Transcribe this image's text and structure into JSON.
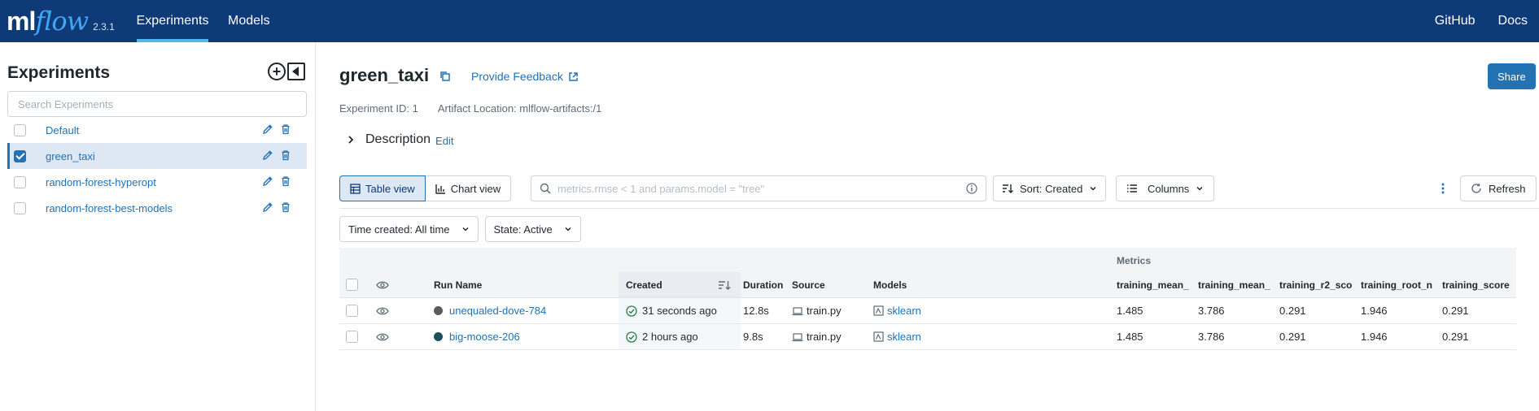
{
  "topbar": {
    "logo_ml": "ml",
    "logo_flow": "flow",
    "version": "2.3.1",
    "nav": [
      {
        "label": "Experiments"
      },
      {
        "label": "Models"
      }
    ],
    "right": [
      {
        "label": "GitHub"
      },
      {
        "label": "Docs"
      }
    ]
  },
  "sidebar": {
    "title": "Experiments",
    "search_placeholder": "Search Experiments",
    "items": [
      {
        "label": "Default",
        "checked": false
      },
      {
        "label": "green_taxi",
        "checked": true
      },
      {
        "label": "random-forest-hyperopt",
        "checked": false
      },
      {
        "label": "random-forest-best-models",
        "checked": false
      }
    ]
  },
  "experiment": {
    "name": "green_taxi",
    "feedback_label": "Provide Feedback",
    "share_label": "Share",
    "id_text": "Experiment ID: 1",
    "artifact_text": "Artifact Location: mlflow-artifacts:/1",
    "description_label": "Description",
    "edit_label": "Edit"
  },
  "toolbar": {
    "table_view": "Table view",
    "chart_view": "Chart view",
    "search_placeholder": "metrics.rmse < 1 and params.model = \"tree\"",
    "sort_label": "Sort: Created",
    "columns_label": "Columns",
    "refresh_label": "Refresh",
    "time_filter": "Time created: All time",
    "state_filter": "State: Active"
  },
  "table": {
    "group_label": "Metrics",
    "headers": {
      "run_name": "Run Name",
      "created": "Created",
      "duration": "Duration",
      "source": "Source",
      "models": "Models",
      "m1": "training_mean_",
      "m2": "training_mean_",
      "m3": "training_r2_sco",
      "m4": "training_root_n",
      "m5": "training_score"
    },
    "rows": [
      {
        "run_name": "unequaled-dove-784",
        "color": "#5b5b5b",
        "created": "31 seconds ago",
        "duration": "12.8s",
        "source": "train.py",
        "model": "sklearn",
        "m1": "1.485",
        "m2": "3.786",
        "m3": "0.291",
        "m4": "1.946",
        "m5": "0.291"
      },
      {
        "run_name": "big-moose-206",
        "color": "#1d4f5e",
        "created": "2 hours ago",
        "duration": "9.8s",
        "source": "train.py",
        "model": "sklearn",
        "m1": "1.485",
        "m2": "3.786",
        "m3": "0.291",
        "m4": "1.946",
        "m5": "0.291"
      }
    ]
  },
  "colors": {
    "topbar": "#0e3a78",
    "accent": "#2272b4",
    "logo_flow": "#42a5f5",
    "success": "#277c43"
  }
}
